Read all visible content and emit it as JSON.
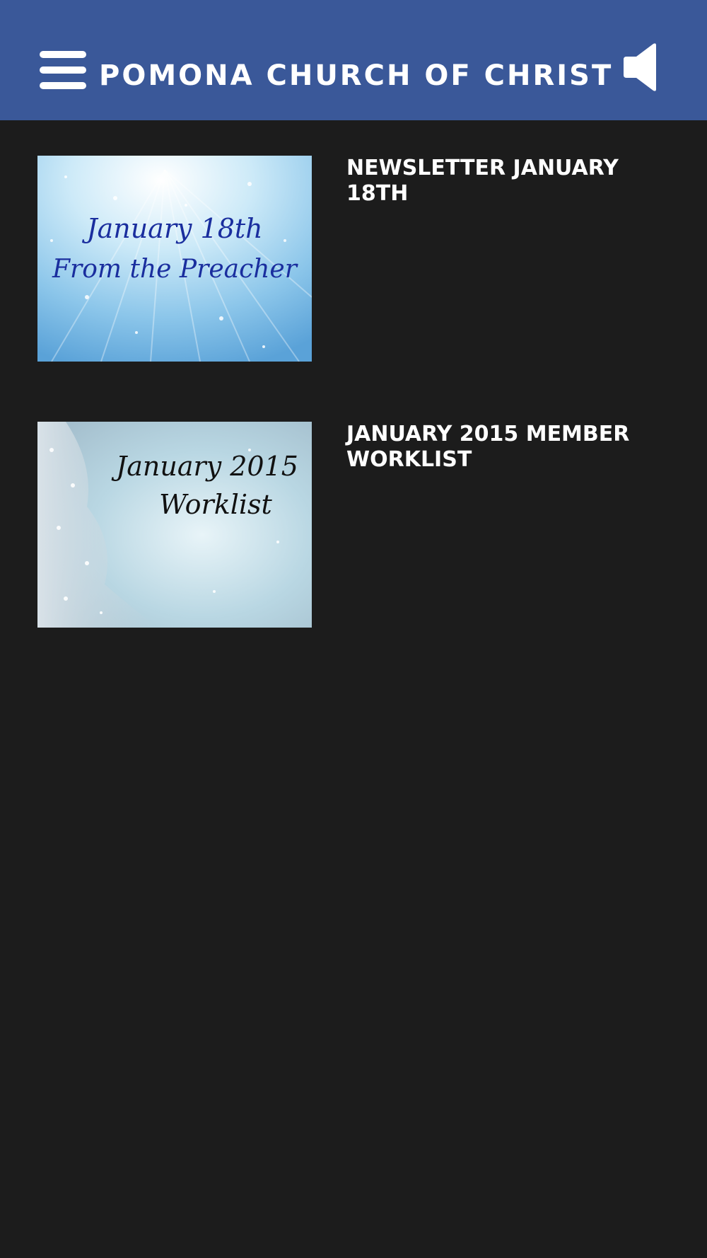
{
  "header": {
    "title": "POMONA CHURCH OF CHRIST",
    "background_color": "#3a5899",
    "menu_icon": "hamburger-menu-icon",
    "sound_icon": "speaker-icon"
  },
  "posts": [
    {
      "title": "NEWSLETTER JANUARY 18TH",
      "thumbnail": {
        "line1": "January 18th",
        "line2": "From the Preacher",
        "text_color": "#1a2e9e"
      }
    },
    {
      "title": "JANUARY 2015 MEMBER WORKLIST",
      "thumbnail": {
        "line1": "January 2015",
        "line2": "Worklist",
        "text_color": "#111111"
      }
    }
  ],
  "colors": {
    "page_background": "#1c1c1c",
    "text": "#ffffff"
  }
}
